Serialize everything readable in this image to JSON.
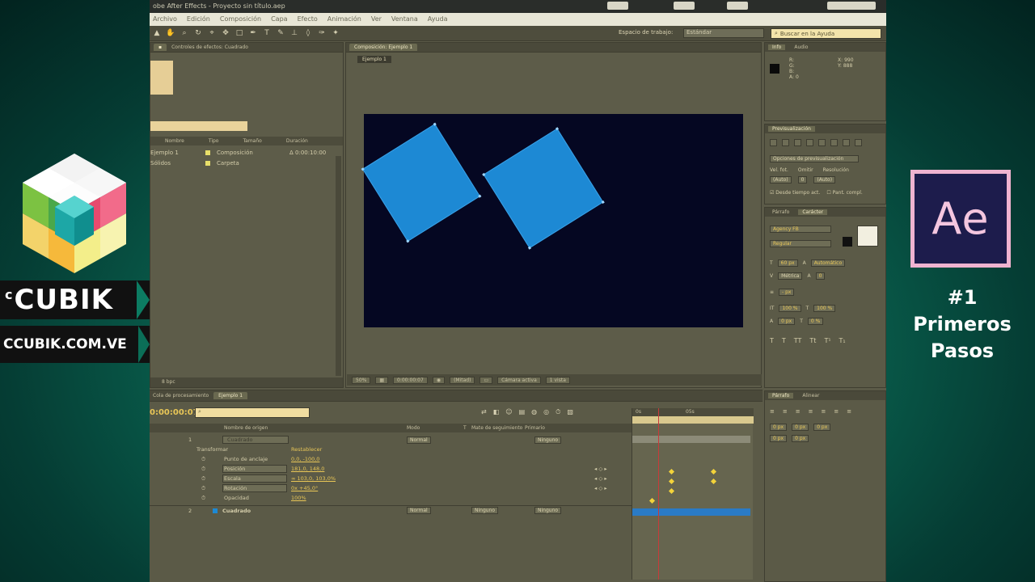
{
  "brand": {
    "name_prefix": "c",
    "name": "CUBIK",
    "url": "CCUBIK.COM.VE",
    "ae_logo_text": "Ae",
    "episode_number": "#1",
    "episode_title_line1": "Primeros",
    "episode_title_line2": "Pasos"
  },
  "app": {
    "title": "obe After Effects - Proyecto sin título.aep",
    "menu": [
      "Archivo",
      "Edición",
      "Composición",
      "Capa",
      "Efecto",
      "Animación",
      "Ver",
      "Ventana",
      "Ayuda"
    ],
    "workspace_label": "Espacio de trabajo:",
    "workspace_value": "Estándar",
    "help_search_placeholder": "Buscar en la Ayuda",
    "project_panel": {
      "tab_label": "Controles de efectos: Cuadrado",
      "columns": [
        "Nombre",
        "Tipo",
        "Tamaño",
        "Duración"
      ],
      "rows": [
        {
          "name": "Ejemplo 1",
          "type": "Composición",
          "duration": "Δ 0:00:10:00"
        },
        {
          "name": "Sólidos",
          "type": "Carpeta",
          "duration": ""
        }
      ],
      "footer_bpc": "8 bpc"
    },
    "composition": {
      "tab_label": "Composición: Ejemplo 1",
      "flow_label": "Ejemplo 1",
      "zoom": "50%",
      "timecode": "0:00:00:07",
      "resolution": "(Mitad)",
      "camera": "Cámara activa",
      "views": "1 vista"
    },
    "timeline": {
      "tab_render": "Cola de procesamiento",
      "tab_comp": "Ejemplo 1",
      "current_time": "0:00:00:07",
      "columns": [
        "Nombre de origen",
        "Modo",
        "T",
        "Mate de seguimiento",
        "Primario"
      ],
      "layers": [
        {
          "index": "1",
          "name": "Cuadrado",
          "mode": "Normal",
          "parent": "Ninguno"
        },
        {
          "index": "2",
          "name": "Cuadrado",
          "mode": "Normal",
          "trkmat": "Ninguno",
          "parent": "Ninguno"
        }
      ],
      "transform": {
        "group_label": "Transformar",
        "reset_label": "Restablecer",
        "properties": [
          {
            "label": "Punto de anclaje",
            "value": "0,0, -100,0"
          },
          {
            "label": "Posición",
            "value": "181,0, 148,0"
          },
          {
            "label": "Escala",
            "value": "∞ 103,0, 103,0%"
          },
          {
            "label": "Rotación",
            "value": "0x +45,0°"
          },
          {
            "label": "Opacidad",
            "value": "100%"
          }
        ]
      },
      "ruler_labels": [
        "0s",
        "05s"
      ]
    },
    "info_panel": {
      "tabs": [
        "Info",
        "Audio"
      ],
      "r": "R:",
      "g": "G:",
      "b": "B:",
      "a": "A:",
      "a_value": "0",
      "x_label": "X:",
      "x_value": "990",
      "y_label": "Y:",
      "y_value": "888"
    },
    "preview_panel": {
      "tab": "Previsualización",
      "options_label": "Opciones de previsualización",
      "frame_rate_label": "Vel. fot.",
      "skip_label": "Omitir",
      "resolution_label": "Resolución",
      "frame_rate_value": "(Auto)",
      "skip_value": "0",
      "resolution_value": "(Auto)",
      "from_current_label": "Desde tiempo act.",
      "full_screen_label": "Pant. compl."
    },
    "character_panel": {
      "tabs": [
        "Párrafo",
        "Carácter"
      ],
      "font": "Agency FB",
      "style": "Regular",
      "size": "60 px",
      "leading": "Automático",
      "kerning": "Métrica",
      "tracking": "0",
      "stroke": "- px",
      "vscale": "100 %",
      "hscale": "100 %",
      "baseline": "0 px",
      "tsume": "0 %"
    },
    "smoother_panel": {
      "tabs": [
        "Párrafo",
        "Alinear"
      ],
      "values": [
        "0 px",
        "0 px",
        "0 px",
        "0 px",
        "0 px"
      ]
    }
  }
}
